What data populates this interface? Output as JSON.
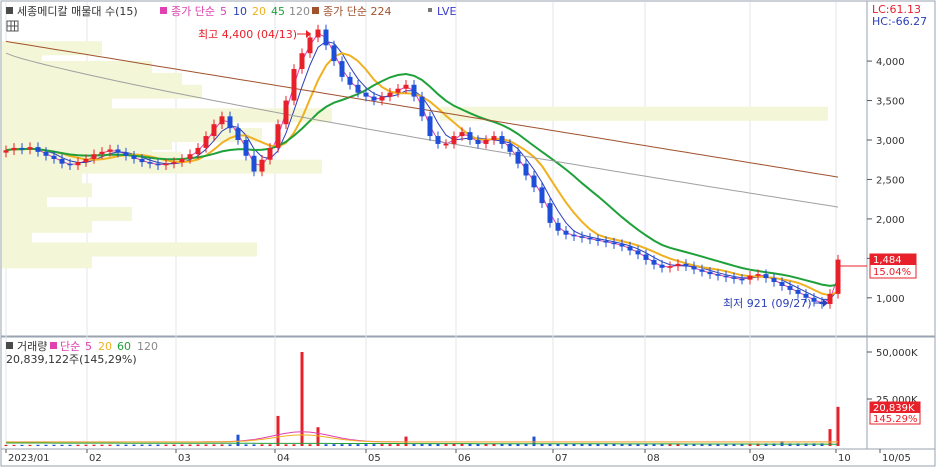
{
  "legend": {
    "stock_name": "세종메디칼 매물대 수(15)",
    "ma_title": "종가 단순",
    "ma_periods": [
      "5",
      "10",
      "20",
      "45",
      "120"
    ],
    "ma_long_title": "종가 단순 224",
    "lve": "LVE"
  },
  "indicator_readout": {
    "lc": "LC:61.13",
    "hc": "HC:-66.27"
  },
  "annotations": {
    "high": "최고 4,400 (04/13)",
    "low": "최저 921 (09/27)"
  },
  "price_tag": {
    "price": "1,484",
    "change": "15.04%"
  },
  "volume_legend": {
    "title": "거래량",
    "ma_title": "단순",
    "ma_periods": [
      "5",
      "20",
      "60",
      "120"
    ],
    "readout": "20,839,122주(145,29%)"
  },
  "volume_tag": {
    "value": "20,839K",
    "ratio": "145.29%"
  },
  "colors": {
    "up": "#e8202a",
    "down": "#1d4fd8",
    "ma5": "#e040b0",
    "ma10": "#2b3fb8",
    "ma20": "#f0b020",
    "ma45": "#1fa13a",
    "ma120": "#a0a0a0",
    "ma224": "#a0522d",
    "lve": "#3a3ad0",
    "profile": "#f4f6d8"
  },
  "chart_data": {
    "type": "candlestick",
    "price_axis": {
      "ticks": [
        1000,
        1500,
        2000,
        2500,
        3000,
        3500,
        4000
      ],
      "tick_labels": [
        "1,000",
        "1,500",
        "2,000",
        "2,500",
        "3,000",
        "3,500",
        "4,000"
      ]
    },
    "volume_axis": {
      "ticks": [
        25000000,
        50000000
      ],
      "tick_labels": [
        "25,000K",
        "50,000K"
      ]
    },
    "x_axis": {
      "labels": [
        "2023/01",
        "02",
        "03",
        "04",
        "05",
        "06",
        "07",
        "08",
        "09",
        "10",
        "10/05"
      ]
    },
    "price_series_approx": [
      2870,
      2900,
      2880,
      2910,
      2850,
      2800,
      2760,
      2700,
      2680,
      2720,
      2760,
      2820,
      2850,
      2880,
      2840,
      2800,
      2760,
      2720,
      2700,
      2680,
      2700,
      2720,
      2760,
      2820,
      2900,
      3050,
      3200,
      3300,
      3150,
      3000,
      2800,
      2600,
      2750,
      2900,
      3200,
      3500,
      3900,
      4100,
      4300,
      4400,
      4200,
      4000,
      3800,
      3700,
      3600,
      3550,
      3500,
      3550,
      3600,
      3650,
      3700,
      3550,
      3300,
      3050,
      2950,
      2950,
      3050,
      3100,
      3000,
      2950,
      3000,
      3050,
      2950,
      2850,
      2700,
      2550,
      2400,
      2200,
      1950,
      1850,
      1800,
      1780,
      1760,
      1740,
      1720,
      1700,
      1680,
      1650,
      1600,
      1550,
      1480,
      1420,
      1380,
      1400,
      1430,
      1400,
      1360,
      1330,
      1300,
      1280,
      1260,
      1240,
      1230,
      1280,
      1300,
      1250,
      1200,
      1150,
      1100,
      1050,
      1000,
      950,
      921,
      1050,
      1484
    ],
    "ma_levels_approx": {
      "ma45": 1300,
      "ma120": 2150,
      "ma224": 2530
    },
    "last_price": 1484,
    "high": 4400,
    "low": 921,
    "last_volume": 20839122
  }
}
